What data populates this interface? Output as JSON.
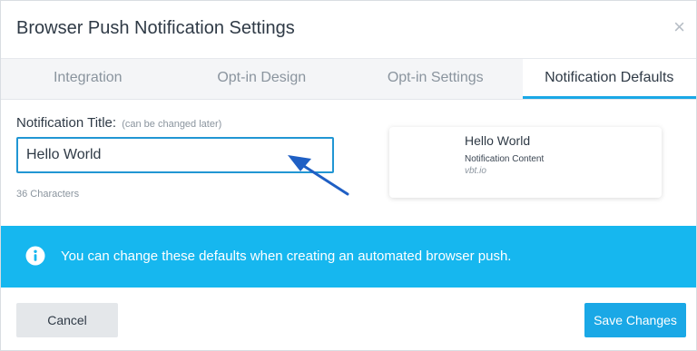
{
  "dialog": {
    "title": "Browser Push Notification Settings",
    "close_icon": "close-icon"
  },
  "tabs": [
    {
      "label": "Integration",
      "active": false
    },
    {
      "label": "Opt-in Design",
      "active": false
    },
    {
      "label": "Opt-in Settings",
      "active": false
    },
    {
      "label": "Notification Defaults",
      "active": true
    }
  ],
  "form": {
    "title_label": "Notification Title:",
    "title_hint": "(can be changed later)",
    "title_value": "Hello World",
    "char_count": "36 Characters"
  },
  "preview": {
    "title": "Hello World",
    "content": "Notification Content",
    "domain": "vbt.io"
  },
  "banner": {
    "icon": "info-icon",
    "text": "You can change these defaults when creating an automated browser push."
  },
  "footer": {
    "cancel_label": "Cancel",
    "save_label": "Save Changes"
  },
  "colors": {
    "accent": "#1aa8e6",
    "banner": "#16b7ef",
    "annotation_arrow": "#1f5fc4"
  }
}
